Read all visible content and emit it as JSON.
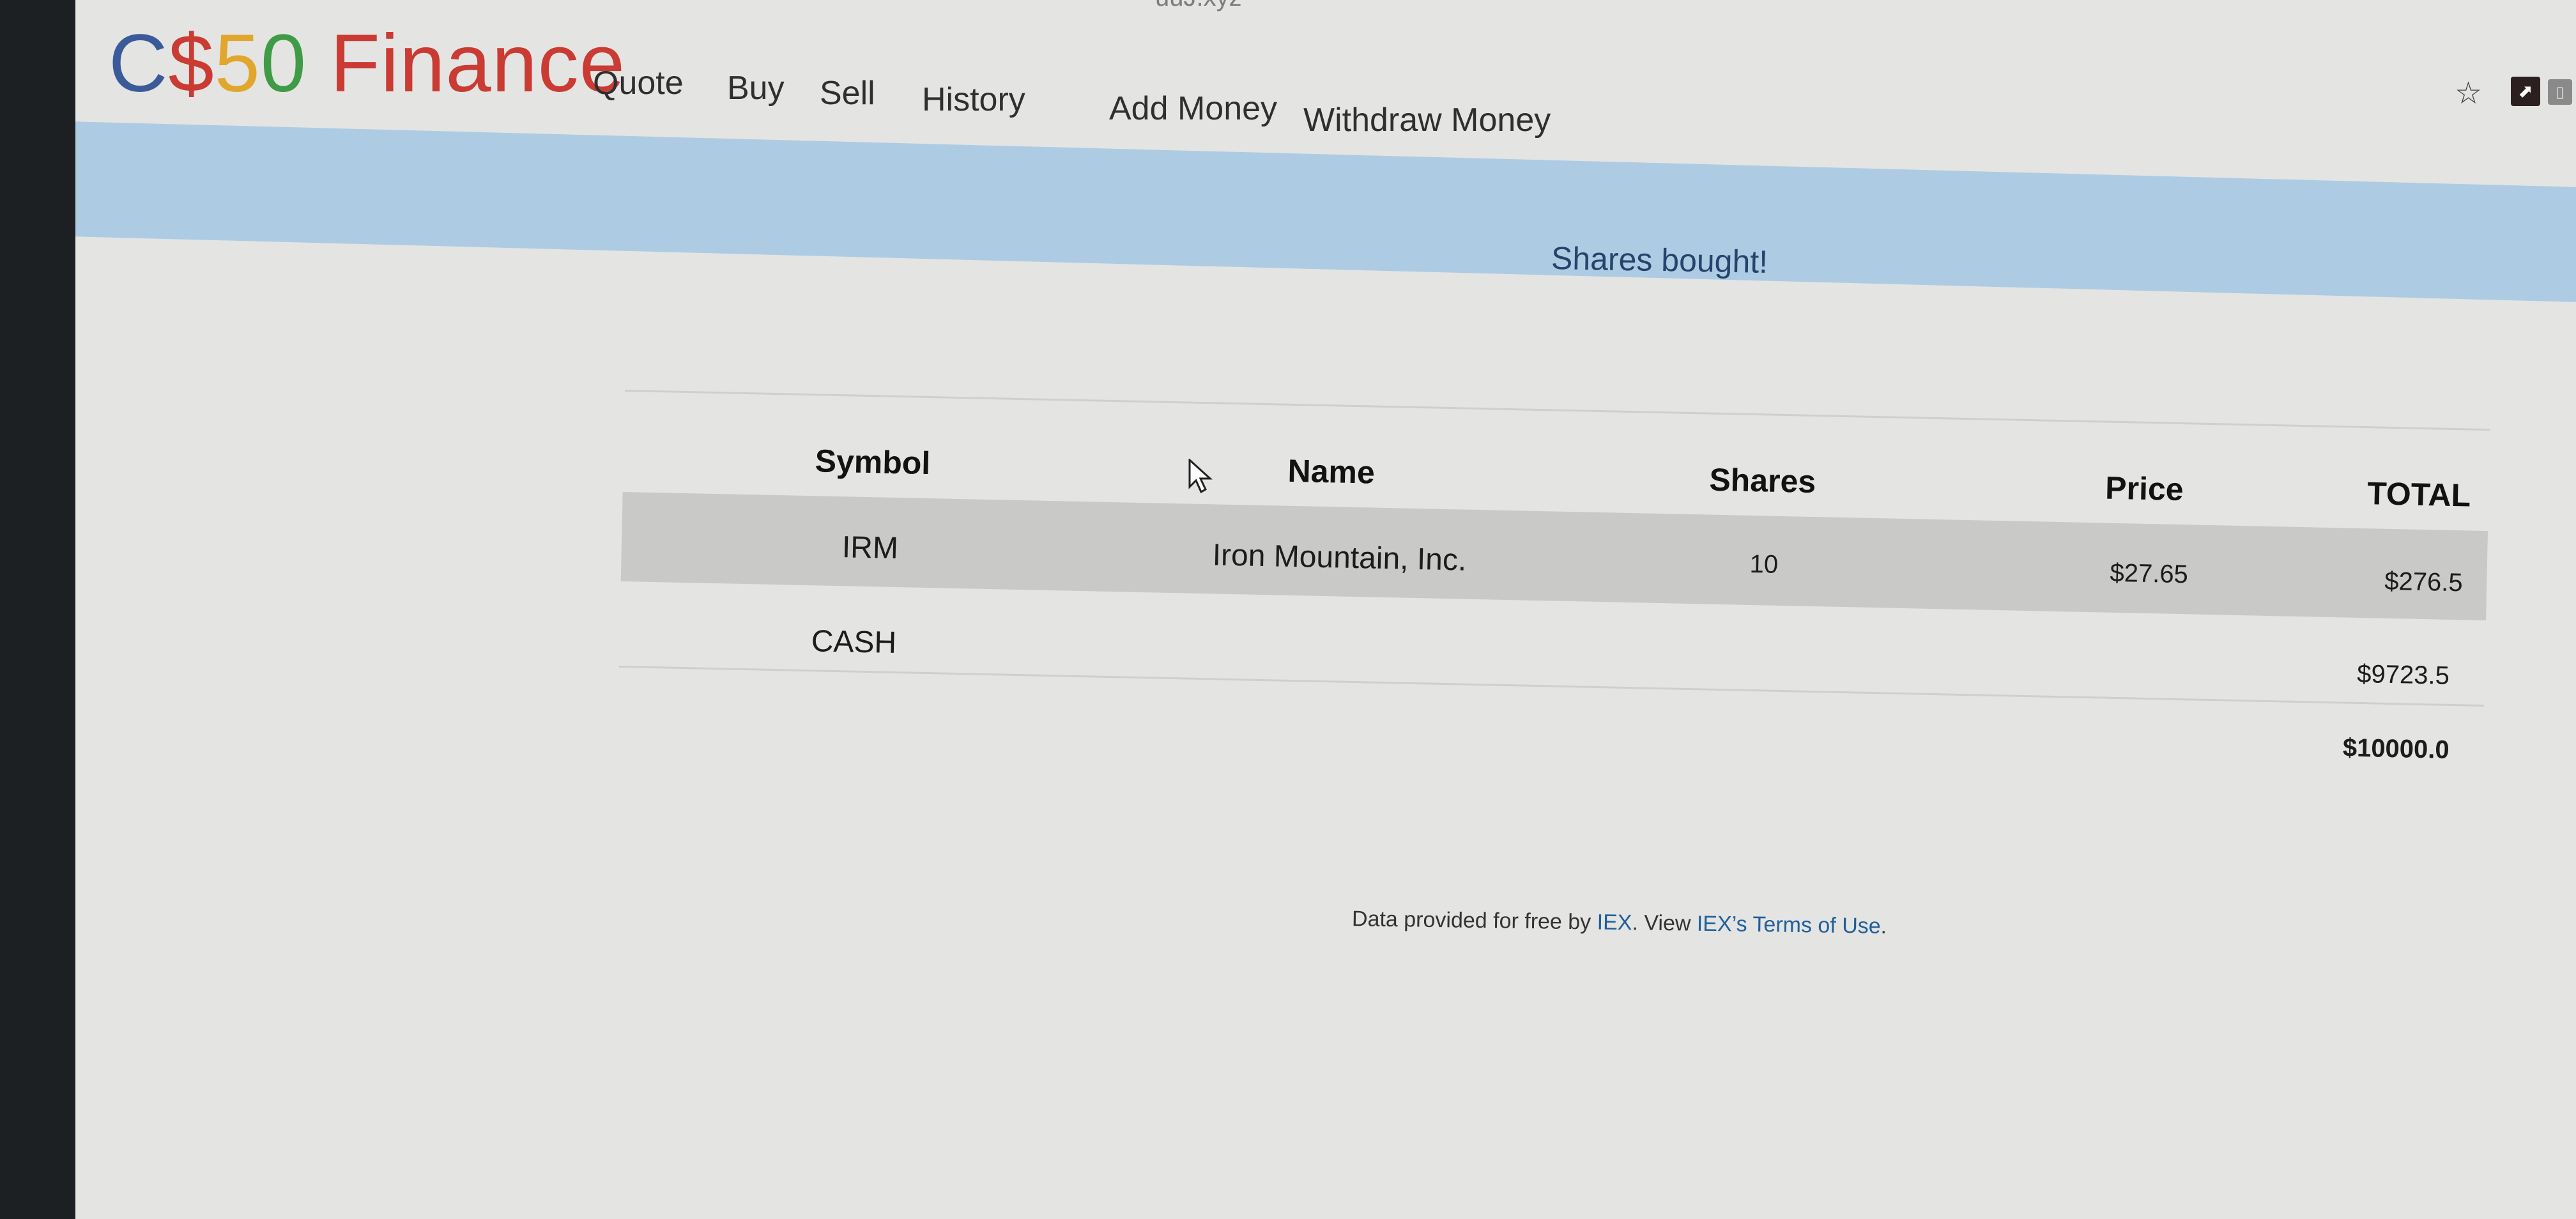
{
  "browser": {
    "url_fragment": "uuJ.xyz",
    "icons": [
      "star-icon",
      "pdf-extension-icon",
      "extension-icon"
    ]
  },
  "brand": {
    "text_c": "C",
    "text_s": "$",
    "text_5": "5",
    "text_0": "0",
    "text_rest": " Finance"
  },
  "nav": {
    "items": [
      "Quote",
      "Buy",
      "Sell",
      "History",
      "Add Money",
      "Withdraw Money"
    ]
  },
  "flash": {
    "message": "Shares bought!"
  },
  "portfolio": {
    "headers": [
      "Symbol",
      "Name",
      "Shares",
      "Price",
      "TOTAL"
    ],
    "rows": [
      {
        "symbol": "IRM",
        "name": "Iron Mountain, Inc.",
        "shares": "10",
        "price": "$27.65",
        "total": "$276.5"
      },
      {
        "symbol": "CASH",
        "name": "",
        "shares": "",
        "price": "",
        "total": "$9723.5"
      }
    ],
    "grand_total": "$10000.0"
  },
  "footer": {
    "prefix": "Data provided for free by ",
    "iex_link": "IEX",
    "middle": ". View ",
    "terms_link": "IEX’s Terms of Use",
    "suffix": "."
  },
  "colors": {
    "brand_blue": "#3b5a9a",
    "brand_red": "#c93b33",
    "brand_yellow": "#e1a62c",
    "brand_green": "#3f9b45",
    "flash_bg": "#aecbe4",
    "flash_text": "#23446b",
    "link": "#1f5f9a"
  }
}
